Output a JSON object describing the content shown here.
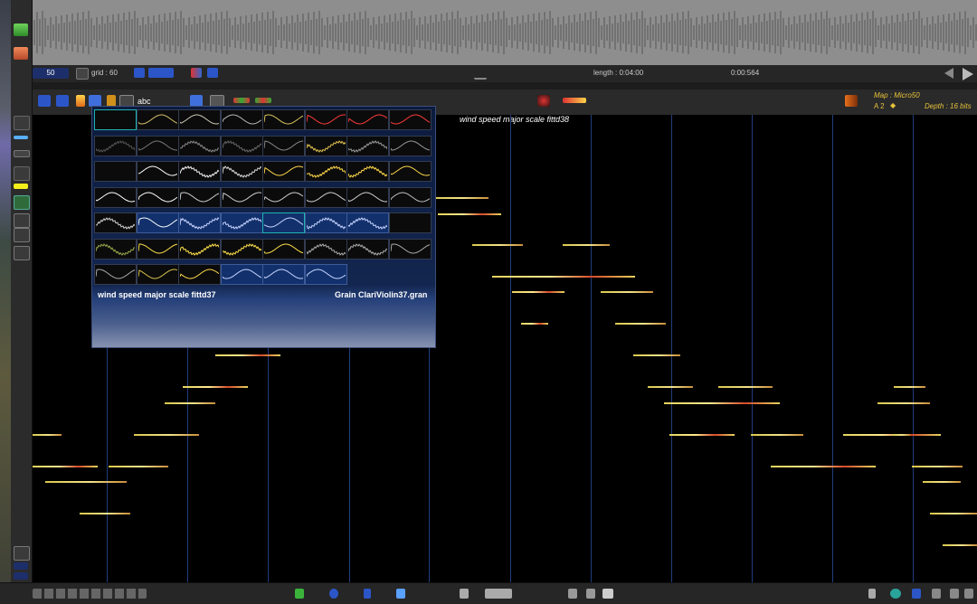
{
  "transport": {
    "zoom_value": "50",
    "grid_label": "grid : 60",
    "length_label": "length : 0:04:00",
    "position_label": "0:00:564"
  },
  "toolbar": {
    "abc_label": "abc",
    "map_label": "Map : Micro50",
    "pitch_label": "A 2",
    "depth_label": "Depth : 16 bits"
  },
  "canvas": {
    "top_label": "wind speed major scale fittd38"
  },
  "popup": {
    "left_name": "wind speed major scale fittd37",
    "right_name": "Grain ClariViolin37.gran",
    "rows": [
      [
        "#3a3a3a",
        "#d6c06a",
        "#cfc9b8",
        "#b9b9b9",
        "#d8c25c",
        "#ff3a3a",
        "#ff3a3a",
        "#ff3a3a"
      ],
      [
        "#555555",
        "#777777",
        "#888888",
        "#666666",
        "#888888",
        "#e0c050",
        "#999999",
        "#999999"
      ],
      [
        "#444444",
        "#ffffff",
        "#f2f2f2",
        "#d6d6d6",
        "#ffd84a",
        "#ffd84a",
        "#ffd84a",
        "#ffd84a"
      ],
      [
        "#ffffff",
        "#ffffff",
        "#cfcfcf",
        "#cfcfcf",
        "#cfcfcf",
        "#cfcfcf",
        "#cfcfcf",
        "#bfbfbf"
      ],
      [
        "#cfcfcf",
        "#ffffff",
        "#c8d4ff",
        "#c8d4ff",
        "#c8d4ff",
        "#c8d4ff",
        "#c8d4ff",
        "#000000"
      ],
      [
        "#9aa64a",
        "#ffe04a",
        "#ffe04a",
        "#ffe04a",
        "#ffe04a",
        "#aaaaaa",
        "#aaaaaa",
        "#aaaaaa"
      ],
      [
        "#aaaaaa",
        "#d8c24a",
        "#ffd84a",
        "#c8d4ff",
        "#c8d4ff",
        "#c8d4ff"
      ]
    ]
  }
}
